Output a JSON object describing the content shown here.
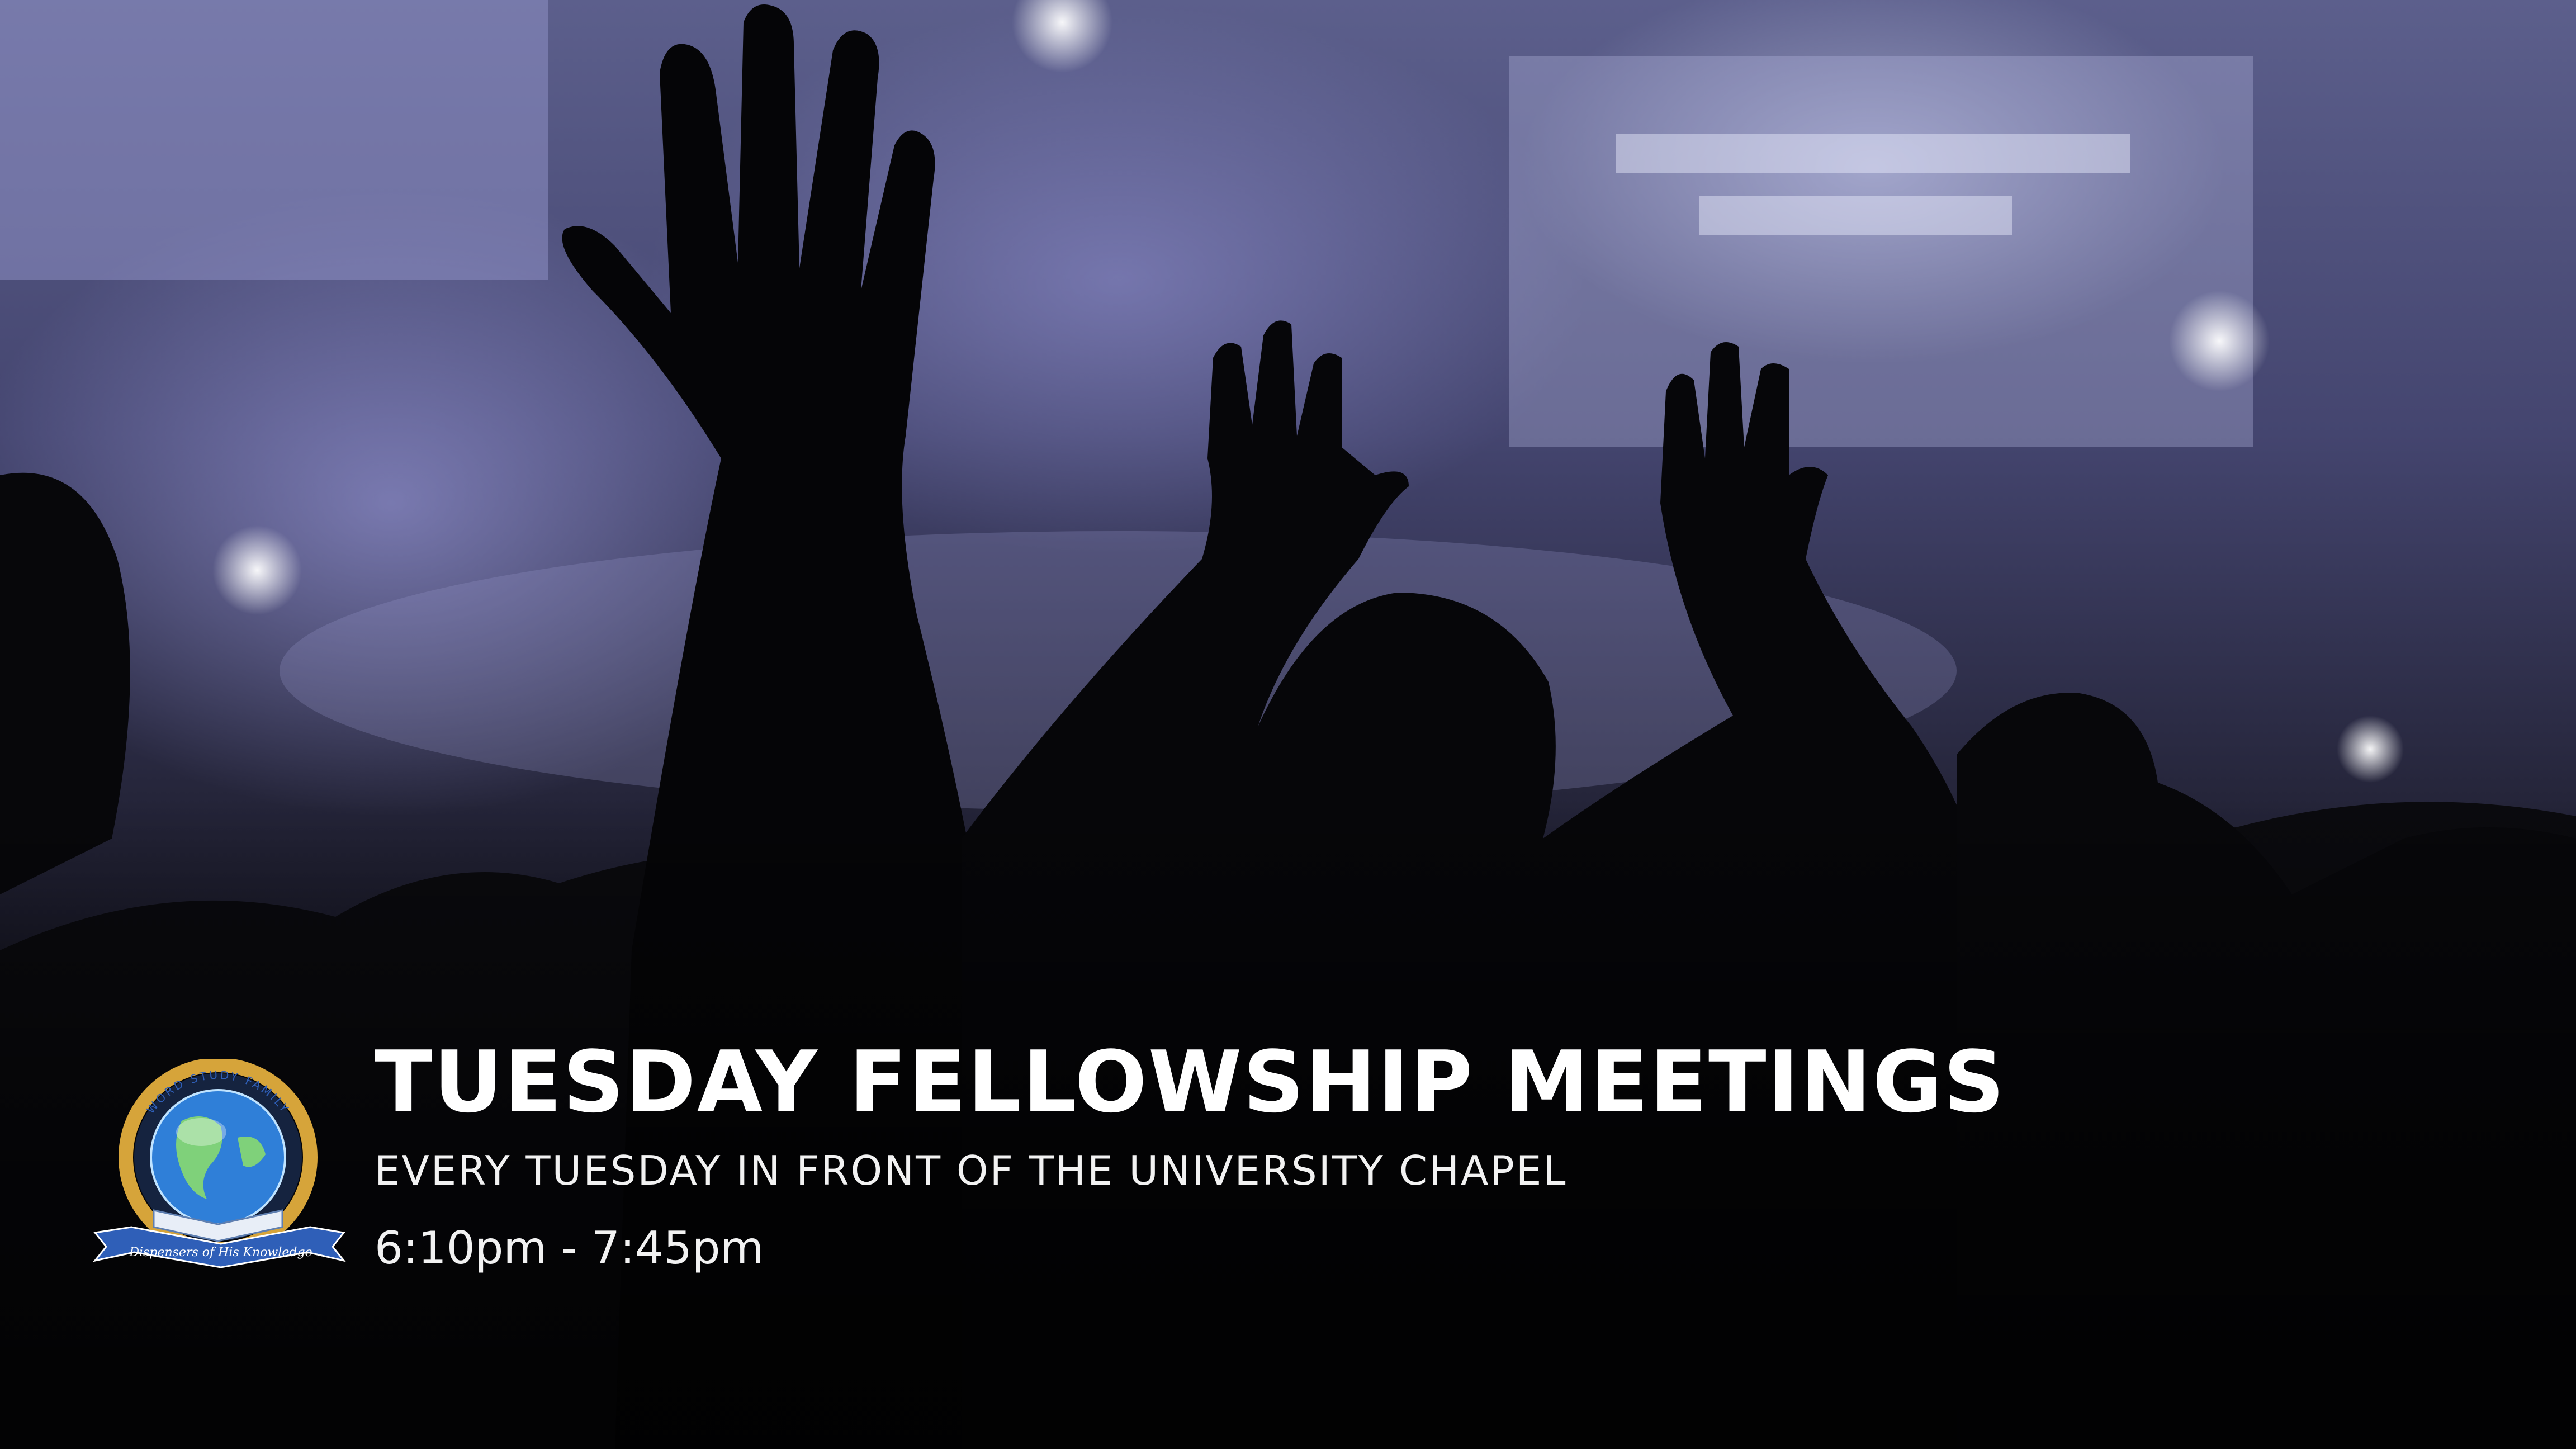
{
  "event": {
    "title": "TUESDAY FELLOWSHIP MEETINGS",
    "location": "EVERY TUESDAY  IN FRONT OF THE UNIVERSITY CHAPEL",
    "time": "6:10pm - 7:45pm"
  },
  "logo": {
    "arc_text": "WORD STUDY FAMILY",
    "ribbon_text": "Dispensers of His Knowledge",
    "icon": "globe-icon"
  },
  "colors": {
    "stage_light": "#c9cbf2",
    "text": "#ffffff",
    "logo_gold": "#d6a43a",
    "logo_blue": "#2f5fb8"
  }
}
